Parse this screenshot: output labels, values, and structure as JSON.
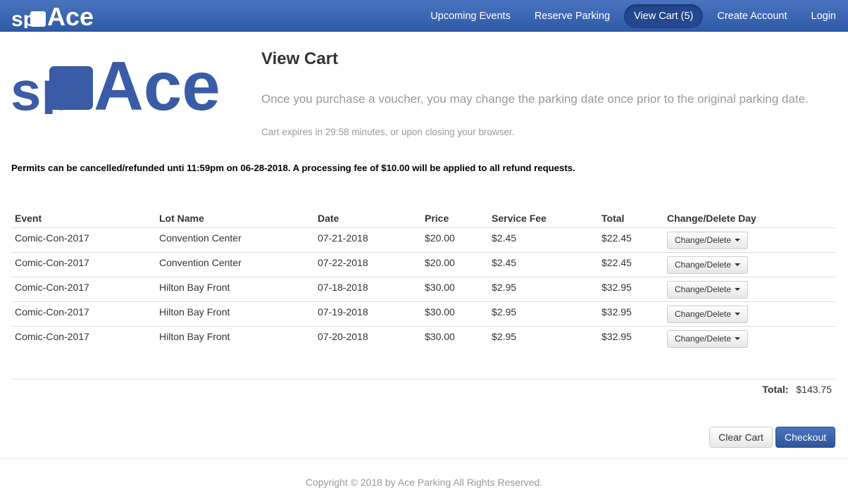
{
  "brand": {
    "letters_small": "sp",
    "letters_big": "Ace",
    "color": "#3a5ba5"
  },
  "nav": {
    "items": [
      {
        "label": "Upcoming Events",
        "active": false
      },
      {
        "label": "Reserve Parking",
        "active": false
      },
      {
        "label": "View Cart (5)",
        "active": true
      },
      {
        "label": "Create Account",
        "active": false
      },
      {
        "label": "Login",
        "active": false
      }
    ]
  },
  "page": {
    "title": "View Cart",
    "lead": "Once you purchase a voucher, you may change the parking date once prior to the original parking date.",
    "expires": "Cart expires in 29:58 minutes, or upon closing your browser.",
    "notice": "Permits can be cancelled/refunded unti 11:59pm on 06-28-2018. A processing fee of $10.00 will be applied to all refund requests."
  },
  "table": {
    "headers": [
      "Event",
      "Lot Name",
      "Date",
      "Price",
      "Service Fee",
      "Total",
      "Change/Delete Day"
    ],
    "rows": [
      {
        "event": "Comic-Con-2017",
        "lot": "Convention Center",
        "date": "07-21-2018",
        "price": "$20.00",
        "fee": "$2.45",
        "total": "$22.45",
        "action": "Change/Delete"
      },
      {
        "event": "Comic-Con-2017",
        "lot": "Convention Center",
        "date": "07-22-2018",
        "price": "$20.00",
        "fee": "$2.45",
        "total": "$22.45",
        "action": "Change/Delete"
      },
      {
        "event": "Comic-Con-2017",
        "lot": "Hilton Bay Front",
        "date": "07-18-2018",
        "price": "$30.00",
        "fee": "$2.95",
        "total": "$32.95",
        "action": "Change/Delete"
      },
      {
        "event": "Comic-Con-2017",
        "lot": "Hilton Bay Front",
        "date": "07-19-2018",
        "price": "$30.00",
        "fee": "$2.95",
        "total": "$32.95",
        "action": "Change/Delete"
      },
      {
        "event": "Comic-Con-2017",
        "lot": "Hilton Bay Front",
        "date": "07-20-2018",
        "price": "$30.00",
        "fee": "$2.95",
        "total": "$32.95",
        "action": "Change/Delete"
      }
    ]
  },
  "summary": {
    "total_label": "Total:",
    "total_value": "$143.75"
  },
  "actions": {
    "clear_label": "Clear Cart",
    "checkout_label": "Checkout"
  },
  "footer": {
    "text": "Copyright © 2018 by Ace Parking All Rights Reserved."
  }
}
